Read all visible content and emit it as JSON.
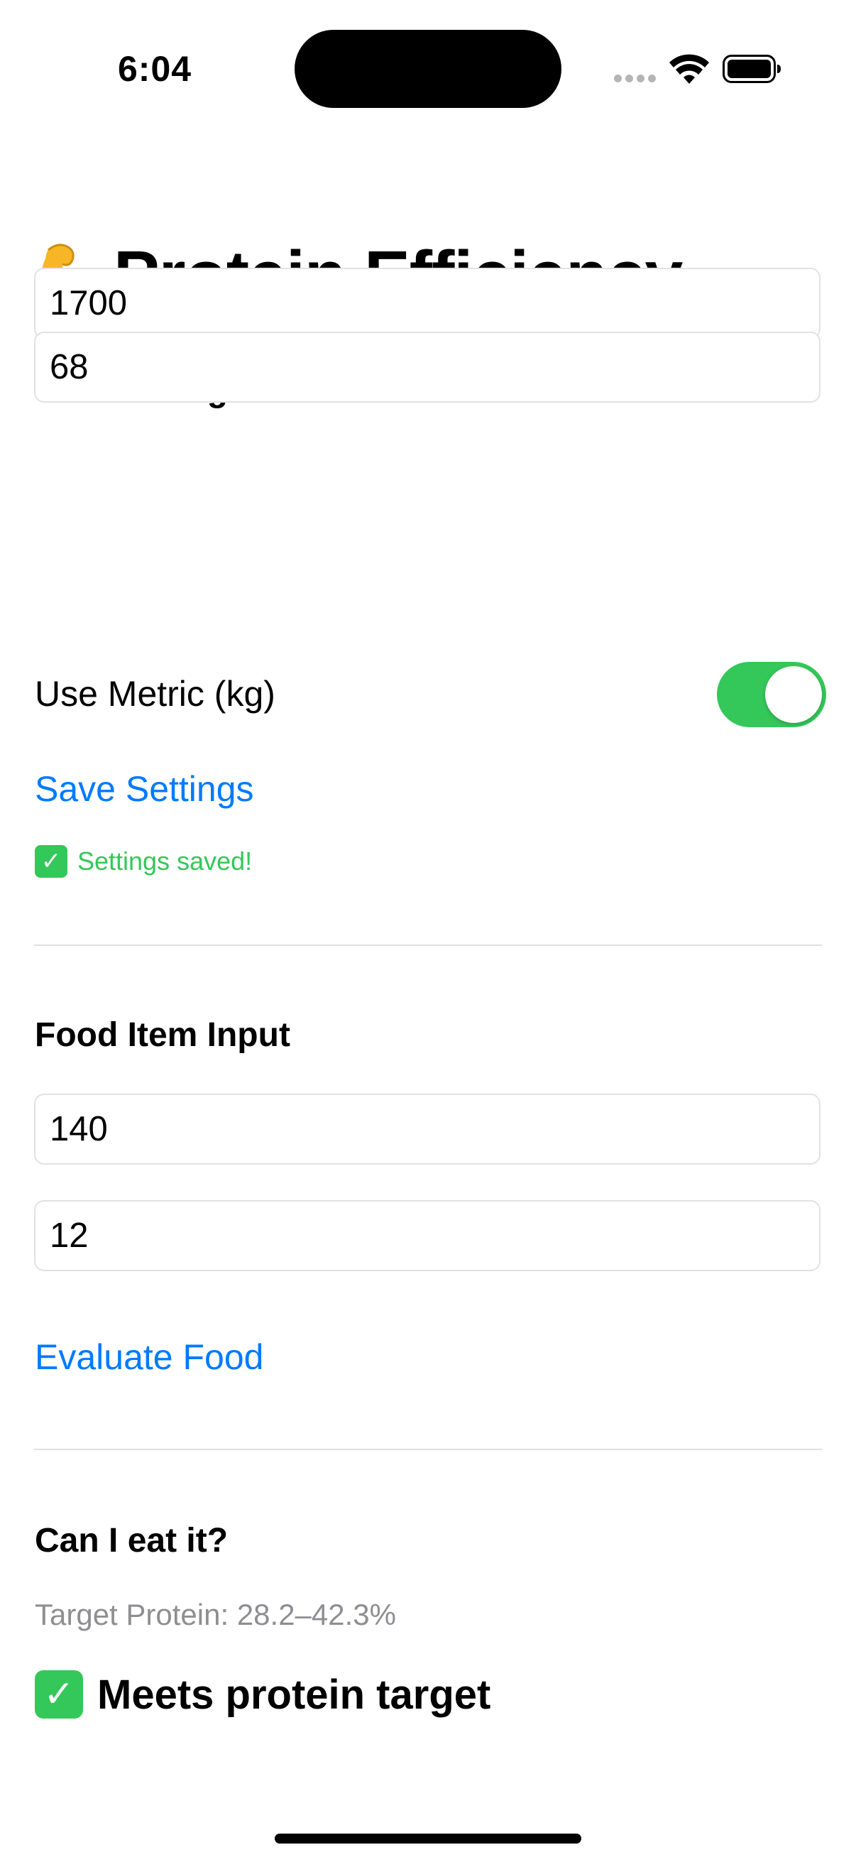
{
  "status_bar": {
    "time": "6:04",
    "icons": [
      "cellular-signal-icon",
      "wifi-icon",
      "battery-icon"
    ]
  },
  "title": {
    "emoji": "flexed-biceps-emoji",
    "text": "Protein Efficiency"
  },
  "user_configuration": {
    "heading": "User Configuration",
    "calories_value": "1700",
    "weight_value": "68",
    "metric_toggle_label": "Use Metric (kg)",
    "metric_toggle_on": true,
    "save_button_label": "Save Settings",
    "saved_message": "Settings saved!"
  },
  "food_item_input": {
    "heading": "Food Item Input",
    "calories_value": "140",
    "protein_value": "12",
    "evaluate_button_label": "Evaluate Food"
  },
  "result": {
    "heading": "Can I eat it?",
    "target_text": "Target Protein: 28.2–42.3%",
    "verdict": "Meets protein target"
  },
  "colors": {
    "accent_blue": "#007aff",
    "success_green": "#34c759",
    "secondary_gray": "#8e8e93"
  }
}
